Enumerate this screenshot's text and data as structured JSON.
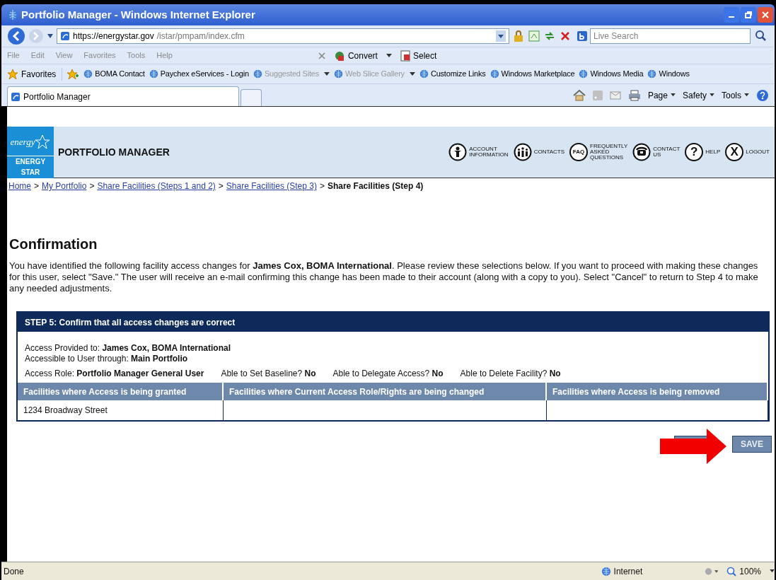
{
  "window": {
    "title": "Portfolio Manager - Windows Internet Explorer"
  },
  "address_bar": {
    "url_host": "https://energystar.gov",
    "url_path": "/istar/pmpam/index.cfm",
    "search_placeholder": "Live Search"
  },
  "menu": [
    "File",
    "Edit",
    "View",
    "Favorites",
    "Tools",
    "Help"
  ],
  "command_bar": [
    "Convert",
    "Select"
  ],
  "favorites_bar": {
    "label": "Favorites",
    "links": [
      {
        "label": "BOMA Contact",
        "disabled": false,
        "dropdown": false
      },
      {
        "label": "Paychex eServices - Login",
        "disabled": false,
        "dropdown": false
      },
      {
        "label": "Suggested Sites",
        "disabled": true,
        "dropdown": true
      },
      {
        "label": "Web Slice Gallery",
        "disabled": true,
        "dropdown": true
      },
      {
        "label": "Customize Links",
        "disabled": false,
        "dropdown": false
      },
      {
        "label": "Windows Marketplace",
        "disabled": false,
        "dropdown": false
      },
      {
        "label": "Windows Media",
        "disabled": false,
        "dropdown": false
      },
      {
        "label": "Windows",
        "disabled": false,
        "dropdown": false
      }
    ]
  },
  "tab": {
    "label": "Portfolio Manager"
  },
  "tab_commands": [
    "Page",
    "Safety",
    "Tools"
  ],
  "page_header": {
    "logo_script": "energy",
    "logo_label": "ENERGY STAR",
    "title": "PORTFOLIO MANAGER",
    "nav": [
      {
        "kind": "person",
        "lines": [
          "ACCOUNT",
          "INFORMATION"
        ]
      },
      {
        "kind": "group",
        "lines": [
          "CONTACTS"
        ]
      },
      {
        "kind": "text",
        "glyph": "FAQ",
        "lines": [
          "FREQUENTLY",
          "ASKED",
          "QUESTIONS"
        ]
      },
      {
        "kind": "phone",
        "lines": [
          "CONTACT",
          "US"
        ]
      },
      {
        "kind": "text",
        "glyph": "?",
        "lines": [
          "HELP"
        ]
      },
      {
        "kind": "text",
        "glyph": "X",
        "lines": [
          "LOGOUT"
        ]
      }
    ]
  },
  "breadcrumb": [
    {
      "label": "Home",
      "link": true
    },
    {
      "separator": ">",
      "label": "My Portfolio",
      "link": true
    },
    {
      "separator": ">",
      "label": "Share Facilities (Steps 1 and 2)",
      "link": true
    },
    {
      "separator": ">",
      "label": "Share Facilities (Step 3)",
      "link": true
    },
    {
      "separator": ">",
      "label": "Share Facilities (Step 4)",
      "link": false
    }
  ],
  "heading": "Confirmation",
  "intro": "You have identified the following facility access changes for **James Cox, BOMA International**. Please review these selections below. If you want to proceed with making these changes for this user, select \"Save.\" The user will receive an e-mail confirming this change has been made to their account (along with a copy to you). Select \"Cancel\" to return to Step 4 to make any needed adjustments.",
  "step_panel": {
    "title": "STEP 5: Confirm that all access changes are correct",
    "details": [
      {
        "label": "Access Provided to:",
        "value": "James Cox, BOMA International"
      },
      {
        "label": "Accessible to User through:",
        "value": "Main Portfolio"
      }
    ],
    "role_line": [
      {
        "label": "Access Role:",
        "value": "Portfolio Manager General User"
      },
      {
        "label": "Able to Set Baseline?",
        "value": "No"
      },
      {
        "label": "Able to Delegate Access?",
        "value": "No"
      },
      {
        "label": "Able to Delete Facility?",
        "value": "No"
      }
    ],
    "table": {
      "columns": [
        "Facilities where Access is being granted",
        "Facilities where Current Access Role/Rights are being changed",
        "Facilities where Access is being removed"
      ],
      "rows": [
        [
          "1234 Broadway Street",
          "",
          ""
        ]
      ]
    }
  },
  "save_button": "SAVE",
  "status_bar": {
    "text": "Done",
    "zone": "Internet",
    "zoom": "100%"
  }
}
